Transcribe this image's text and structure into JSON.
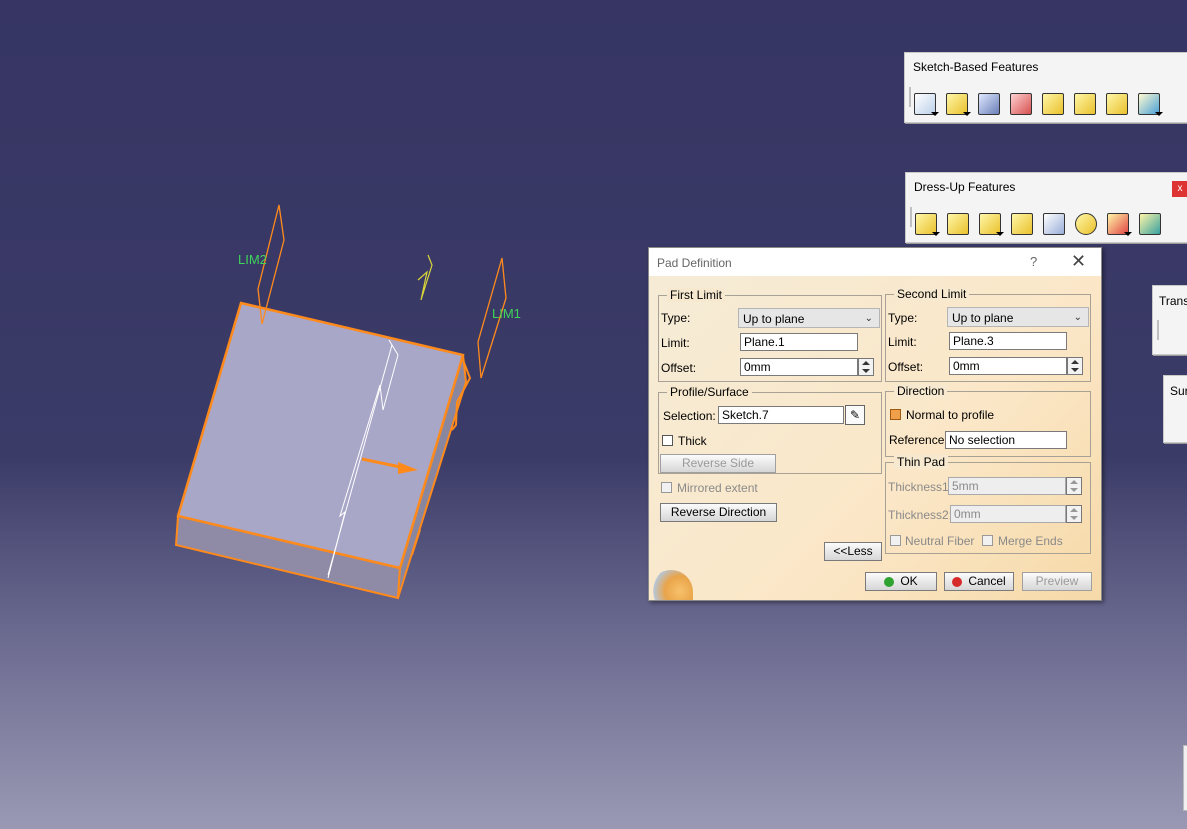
{
  "viewport": {
    "labels": [
      "LIM2",
      "LIM1"
    ]
  },
  "toolbars": {
    "sketch_based": {
      "title": "Sketch-Based Features",
      "icons": [
        "pad-icon",
        "pocket-icon",
        "shaft-icon",
        "groove-icon",
        "hole-icon",
        "rib-icon",
        "slot-icon",
        "multi-section-solid-icon"
      ]
    },
    "dress_up": {
      "title": "Dress-Up Features",
      "close": "x",
      "icons": [
        "edge-fillet-icon",
        "chamfer-icon",
        "draft-icon",
        "shell-icon",
        "thickness-icon",
        "thread-icon",
        "remove-face-icon",
        "replace-face-icon"
      ]
    },
    "transformations": {
      "title": "Trans"
    },
    "surface": {
      "title": "Sur"
    }
  },
  "dialog": {
    "title": "Pad Definition",
    "help": "?",
    "close": "✕",
    "first_limit": {
      "legend": "First Limit",
      "type_label": "Type:",
      "type_value": "Up to plane",
      "limit_label": "Limit:",
      "limit_value": "Plane.1",
      "offset_label": "Offset:",
      "offset_value": "0mm"
    },
    "second_limit": {
      "legend": "Second Limit",
      "type_label": "Type:",
      "type_value": "Up to plane",
      "limit_label": "Limit:",
      "limit_value": "Plane.3",
      "offset_label": "Offset:",
      "offset_value": "0mm"
    },
    "profile": {
      "legend": "Profile/Surface",
      "selection_label": "Selection:",
      "selection_value": "Sketch.7",
      "thick_label": "Thick",
      "reverse_side": "Reverse Side"
    },
    "mirrored_extent": "Mirrored extent",
    "reverse_direction": "Reverse Direction",
    "direction": {
      "legend": "Direction",
      "normal_label": "Normal to profile",
      "reference_label": "Reference:",
      "reference_value": "No selection"
    },
    "thin_pad": {
      "legend": "Thin Pad",
      "thickness1_label": "Thickness1",
      "thickness1_value": "5mm",
      "thickness2_label": "Thickness2:",
      "thickness2_value": "0mm",
      "neutral_fiber": "Neutral Fiber",
      "merge_ends": "Merge Ends"
    },
    "less": "<<Less",
    "ok": "OK",
    "cancel": "Cancel",
    "preview": "Preview",
    "colors": {
      "ok_dot": "#2fa32f",
      "cancel_dot": "#d62a2a"
    }
  }
}
